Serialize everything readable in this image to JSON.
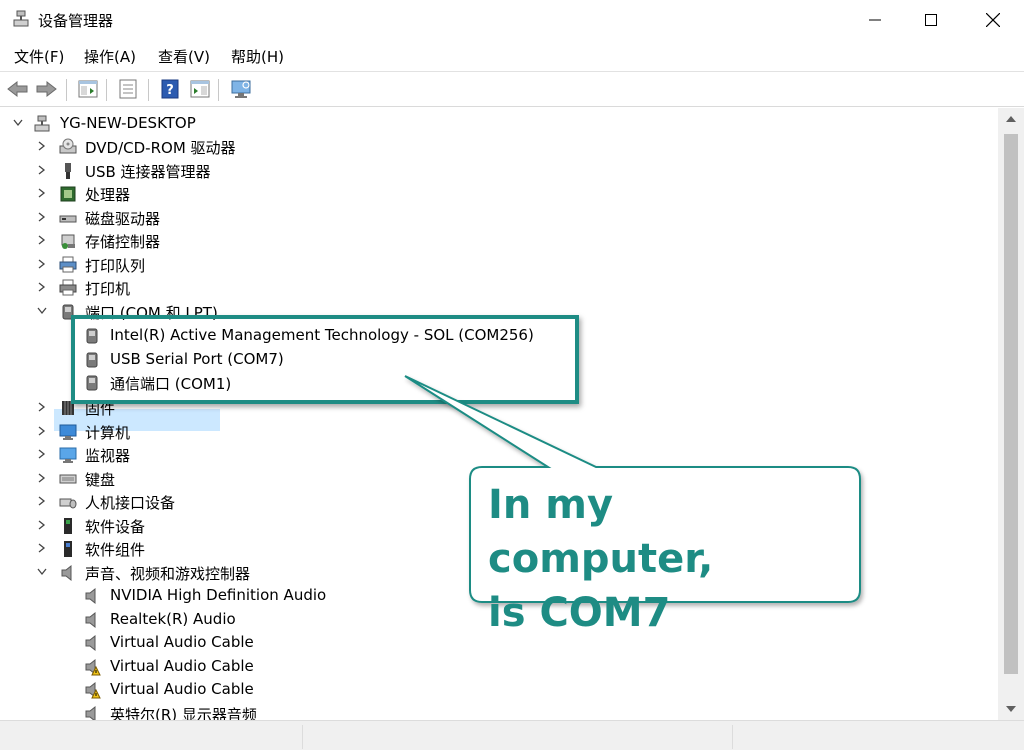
{
  "window": {
    "title": "设备管理器"
  },
  "menu": [
    {
      "label": "文件(F)"
    },
    {
      "label": "操作(A)"
    },
    {
      "label": "查看(V)"
    },
    {
      "label": "帮助(H)"
    }
  ],
  "toolbar": {
    "icons": [
      "back-arrow-icon",
      "forward-arrow-icon",
      "show-hide-tree-icon",
      "properties-icon",
      "help-icon",
      "action-pane-icon",
      "scan-hardware-icon"
    ]
  },
  "tree": {
    "root": "YG-NEW-DESKTOP",
    "items": [
      {
        "label": "DVD/CD-ROM 驱动器",
        "icon": "dvd-drive-icon",
        "expanded": false
      },
      {
        "label": "USB 连接器管理器",
        "icon": "usb-connector-icon",
        "expanded": false
      },
      {
        "label": "处理器",
        "icon": "processor-icon",
        "expanded": false
      },
      {
        "label": "磁盘驱动器",
        "icon": "disk-drive-icon",
        "expanded": false
      },
      {
        "label": "存储控制器",
        "icon": "storage-controller-icon",
        "expanded": false
      },
      {
        "label": "打印队列",
        "icon": "print-queue-icon",
        "expanded": false
      },
      {
        "label": "打印机",
        "icon": "printer-icon",
        "expanded": false
      },
      {
        "label": "端口 (COM 和 LPT)",
        "icon": "port-icon",
        "expanded": true,
        "selected": true
      },
      {
        "label": "固件",
        "icon": "firmware-icon",
        "expanded": false
      },
      {
        "label": "计算机",
        "icon": "computer-icon",
        "expanded": false
      },
      {
        "label": "监视器",
        "icon": "monitor-icon",
        "expanded": false
      },
      {
        "label": "键盘",
        "icon": "keyboard-icon",
        "expanded": false
      },
      {
        "label": "人机接口设备",
        "icon": "hid-icon",
        "expanded": false
      },
      {
        "label": "软件设备",
        "icon": "software-device-icon",
        "expanded": false
      },
      {
        "label": "软件组件",
        "icon": "software-component-icon",
        "expanded": false
      },
      {
        "label": "声音、视频和游戏控制器",
        "icon": "speaker-icon",
        "expanded": true
      }
    ],
    "ports": [
      {
        "label": "Intel(R) Active Management Technology - SOL (COM256)"
      },
      {
        "label": "USB Serial Port (COM7)"
      },
      {
        "label": "通信端口 (COM1)"
      }
    ],
    "audio": [
      {
        "label": "NVIDIA High Definition Audio",
        "warning": false
      },
      {
        "label": "Realtek(R) Audio",
        "warning": false
      },
      {
        "label": "Virtual Audio Cable",
        "warning": false
      },
      {
        "label": "Virtual Audio Cable",
        "warning": true
      },
      {
        "label": "Virtual Audio Cable",
        "warning": true
      },
      {
        "label": "英特尔(R) 显示器音频",
        "warning": false
      }
    ]
  },
  "annotation": {
    "line1": "In my computer,",
    "line2": "is COM7",
    "color": "#1e8c84"
  }
}
